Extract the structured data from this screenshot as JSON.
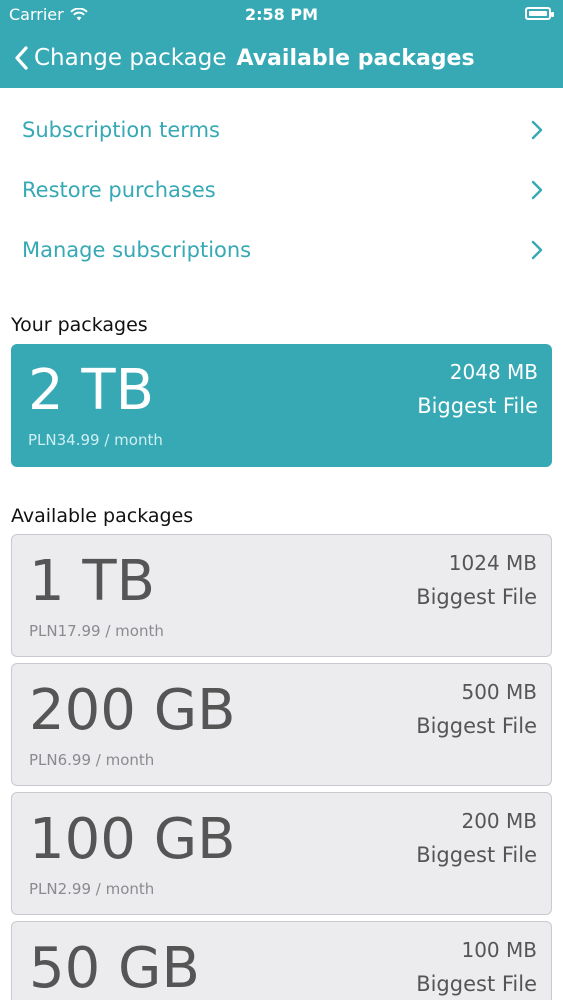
{
  "status_bar": {
    "carrier": "Carrier",
    "time": "2:58 PM",
    "icons": [
      "wifi-icon",
      "battery-icon"
    ]
  },
  "nav": {
    "back_label": "Change package",
    "title": "Available packages"
  },
  "menu": {
    "items": [
      {
        "label": "Subscription terms"
      },
      {
        "label": "Restore purchases"
      },
      {
        "label": "Manage subscriptions"
      }
    ]
  },
  "sections": {
    "your_packages": "Your packages",
    "available_packages": "Available packages"
  },
  "current_package": {
    "size": "2 TB",
    "price": "PLN34.99 / month",
    "file_limit": "2048 MB",
    "file_limit_label": "Biggest File"
  },
  "packages": [
    {
      "size": "1 TB",
      "price": "PLN17.99 / month",
      "file_limit": "1024 MB",
      "file_limit_label": "Biggest File"
    },
    {
      "size": "200 GB",
      "price": "PLN6.99 / month",
      "file_limit": "500 MB",
      "file_limit_label": "Biggest File"
    },
    {
      "size": "100 GB",
      "price": "PLN2.99 / month",
      "file_limit": "200 MB",
      "file_limit_label": "Biggest File"
    },
    {
      "size": "50 GB",
      "price": "",
      "file_limit": "100 MB",
      "file_limit_label": "Biggest File"
    }
  ],
  "colors": {
    "accent": "#36a9b5",
    "card_inactive_bg": "#ececef",
    "card_inactive_border": "#c9c9cf"
  }
}
